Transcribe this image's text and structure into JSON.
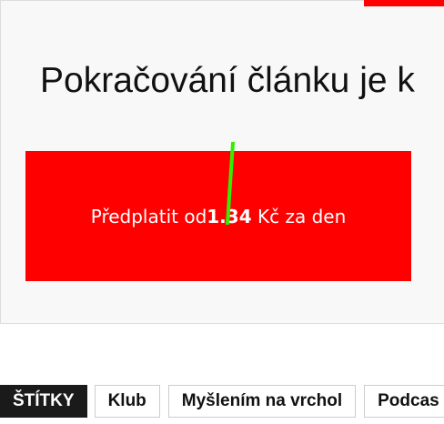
{
  "paywall": {
    "heading": "Pokračování článku je k",
    "button": {
      "prefix": "Předplatit od",
      "price": "1.34",
      "suffix": " Kč za den"
    }
  },
  "tags": {
    "label": "ŠTÍTKY",
    "items": [
      {
        "label": "Klub"
      },
      {
        "label": "Myšlením na vrchol"
      },
      {
        "label": "Podcas"
      }
    ]
  },
  "colors": {
    "accent": "#ff0000",
    "annotation_mark": "#33ee00"
  },
  "icons": {
    "annotation": "green-stroke-mark"
  }
}
